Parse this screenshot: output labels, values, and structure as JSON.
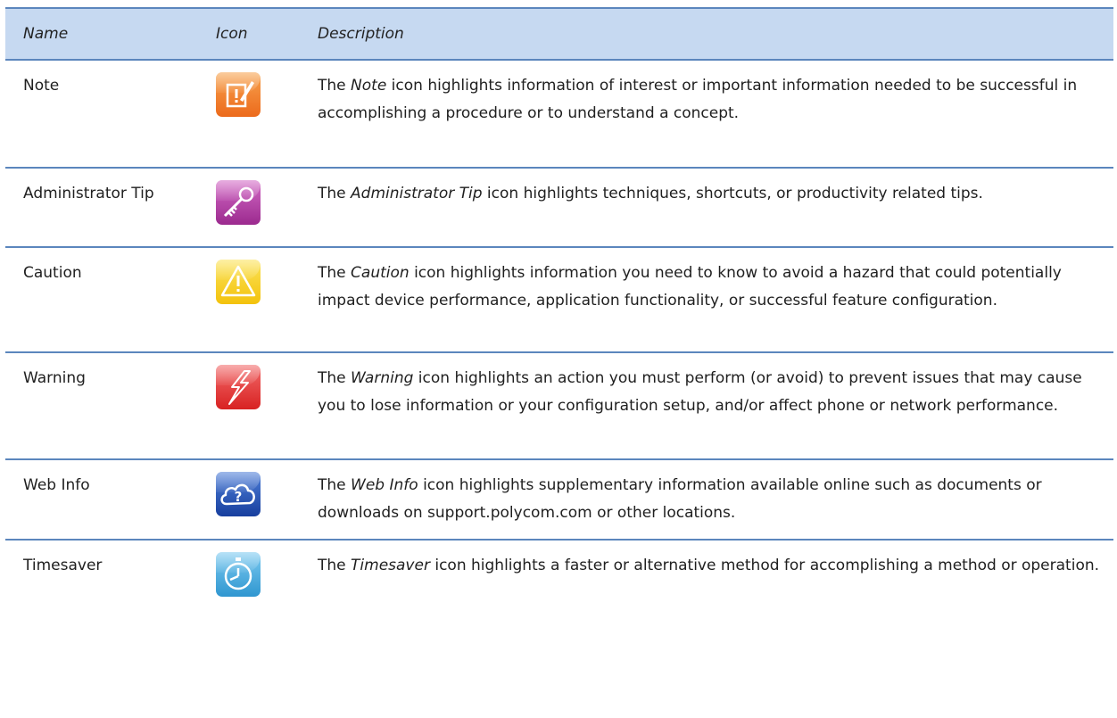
{
  "header": {
    "name": "Name",
    "icon": "Icon",
    "description": "Description"
  },
  "rows": [
    {
      "name": "Note",
      "icon": "note-icon",
      "color": "#f0822a",
      "desc_prefix": "The ",
      "desc_em": "Note",
      "desc_suffix": " icon highlights information of interest or important information needed to be successful in accomplishing a procedure or to understand a concept."
    },
    {
      "name": "Administrator Tip",
      "icon": "key-icon",
      "color": "#b23fa3",
      "desc_prefix": "The ",
      "desc_em": "Administrator Tip",
      "desc_suffix": " icon highlights techniques, shortcuts, or productivity related tips."
    },
    {
      "name": "Caution",
      "icon": "caution-icon",
      "color": "#f6cf1c",
      "desc_prefix": "The ",
      "desc_em": "Caution",
      "desc_suffix": " icon highlights information you need to know to avoid a hazard that could potentially impact device performance, application functionality, or successful feature configuration."
    },
    {
      "name": "Warning",
      "icon": "warning-icon",
      "color": "#e23a3a",
      "desc_prefix": "The ",
      "desc_em": "Warning",
      "desc_suffix": " icon highlights an action you must perform (or avoid) to prevent issues that may cause you to lose information or your configuration setup, and/or affect phone or network performance."
    },
    {
      "name": "Web Info",
      "icon": "web-info-icon",
      "color": "#2a55b8",
      "desc_prefix": "The ",
      "desc_em": "Web Info",
      "desc_suffix": " icon highlights supplementary information available online such as documents or downloads on support.polycom.com or other locations."
    },
    {
      "name": "Timesaver",
      "icon": "timesaver-icon",
      "color": "#4aaee0",
      "desc_prefix": "The ",
      "desc_em": "Timesaver",
      "desc_suffix": " icon highlights a faster or alternative method for accomplishing a method or operation."
    }
  ]
}
